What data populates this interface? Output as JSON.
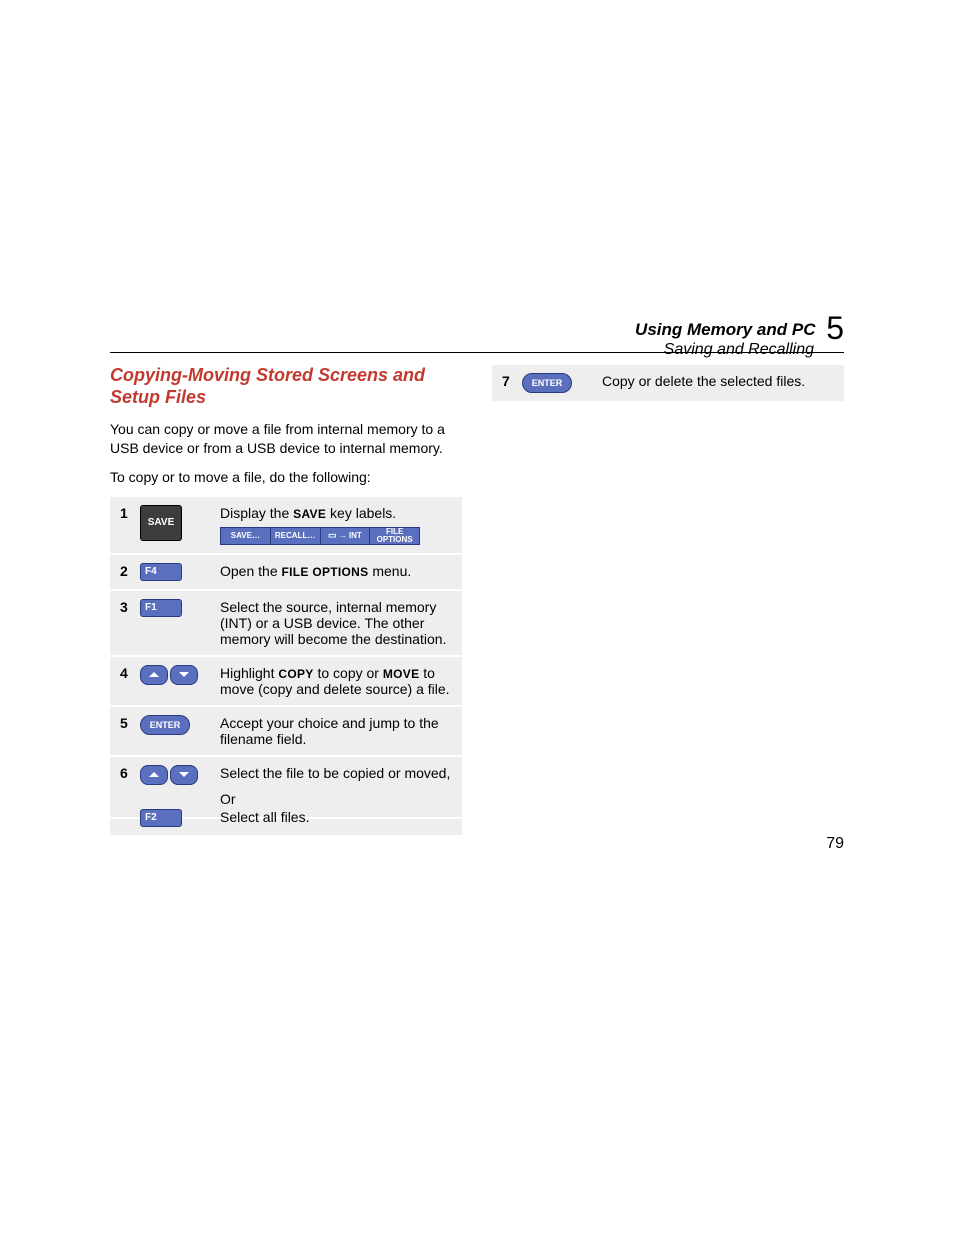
{
  "header": {
    "title": "Using Memory and PC",
    "subtitle": "Saving and Recalling",
    "chapter_number": "5"
  },
  "section": {
    "title": "Copying-Moving Stored Screens and Setup Files",
    "intro": "You can copy or move a file from internal memory to a USB device or from a USB device to internal memory.",
    "lead": "To copy or to move a file, do the following:"
  },
  "keys": {
    "save": "SAVE",
    "f4": "F4",
    "f1": "F1",
    "f2": "F2",
    "enter": "ENTER"
  },
  "menubar": {
    "save": "SAVE…",
    "recall": "RECALL…",
    "int": "→ INT",
    "file_options_l1": "FILE",
    "file_options_l2": "OPTIONS"
  },
  "steps": {
    "s1": {
      "num": "1",
      "pre": "Display the ",
      "sc": "SAVE",
      "post": " key labels."
    },
    "s2": {
      "num": "2",
      "pre": "Open the ",
      "sc": "FILE OPTIONS",
      "post": " menu."
    },
    "s3": {
      "num": "3",
      "text": "Select the source, internal memory (INT) or a USB device. The other memory will become the destination."
    },
    "s4": {
      "num": "4",
      "pre": "Highlight ",
      "sc1": "COPY",
      "mid": " to copy or ",
      "sc2": "MOVE",
      "post": " to move (copy and delete source) a file."
    },
    "s5": {
      "num": "5",
      "text": "Accept your choice and jump to the filename field."
    },
    "s6": {
      "num": "6",
      "text1": "Select the file to be copied or moved,",
      "or": "Or",
      "text2": "Select all files."
    },
    "s7": {
      "num": "7",
      "text": "Copy or delete the selected files."
    }
  },
  "page_number": "79"
}
